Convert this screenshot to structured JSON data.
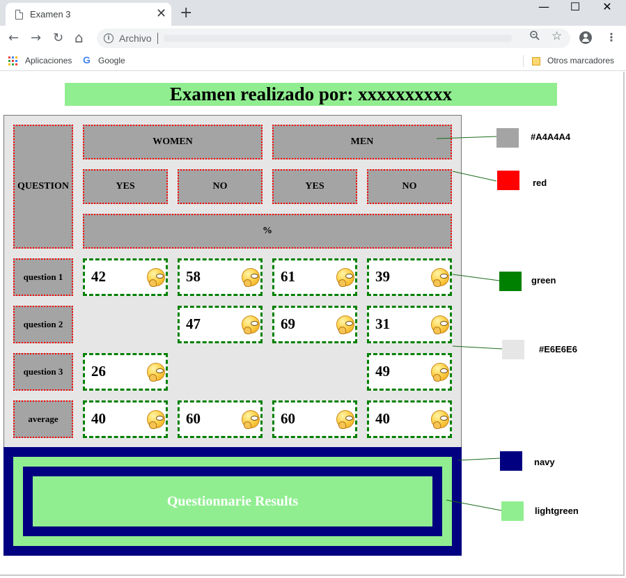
{
  "browser": {
    "tab_title": "Examen 3",
    "close_glyph": "✕",
    "newtab_glyph": "+",
    "window_controls": [
      "—",
      "☐",
      "✕"
    ],
    "nav": {
      "back": "←",
      "forward": "→",
      "reload": "↻",
      "home": "⌂"
    },
    "address": {
      "scheme_label": "Archivo",
      "info_glyph": "i"
    },
    "bookmarks": {
      "apps": "Aplicaciones",
      "google": "Google",
      "google_glyph": "G",
      "other": "Otros marcadores"
    },
    "icons": {
      "zoom": "zoom-icon",
      "star": "☆",
      "menu": "⋮"
    }
  },
  "page": {
    "title": "Examen realizado por: xxxxxxxxxx",
    "headers": {
      "question": "QUESTION",
      "women": "WOMEN",
      "men": "MEN",
      "yes_1": "YES",
      "no_1": "NO",
      "yes_2": "YES",
      "no_2": "NO",
      "percent": "%"
    },
    "rows": [
      {
        "label": "question 1",
        "values": [
          "42",
          "58",
          "61",
          "39"
        ]
      },
      {
        "label": "question 2",
        "values": [
          "",
          "47",
          "69",
          "31"
        ]
      },
      {
        "label": "question 3",
        "values": [
          "26",
          "",
          "",
          "49"
        ]
      },
      {
        "label": "average",
        "values": [
          "40",
          "60",
          "60",
          "40"
        ]
      }
    ],
    "results_button": "Questionnarie Results",
    "legend": [
      {
        "label": "#A4A4A4",
        "color": "#A4A4A4"
      },
      {
        "label": "red",
        "color": "#FF0000"
      },
      {
        "label": "green",
        "color": "#008000"
      },
      {
        "label": "#E6E6E6",
        "color": "#E6E6E6"
      },
      {
        "label": "navy",
        "color": "#000080"
      },
      {
        "label": "lightgreen",
        "color": "#90EE90"
      }
    ]
  }
}
